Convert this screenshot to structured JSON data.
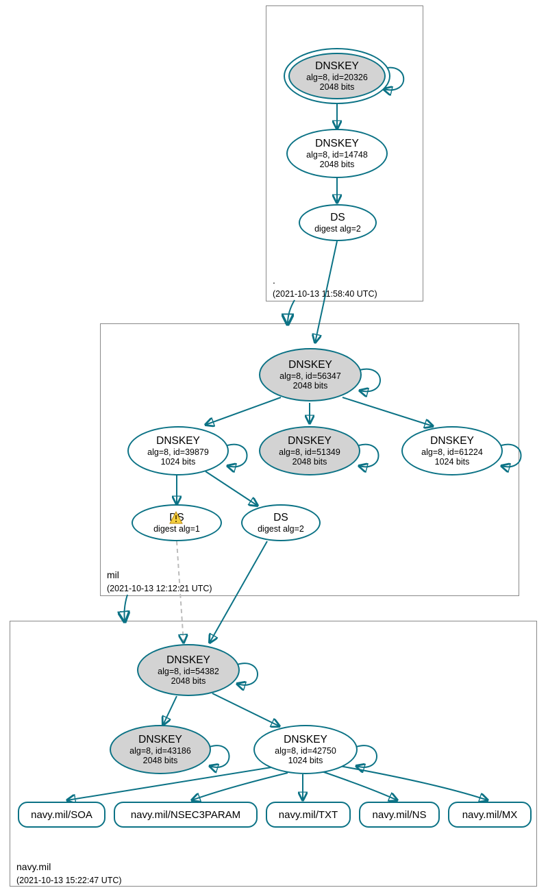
{
  "colors": {
    "accent": "#0b7285",
    "fill": "#d3d3d3"
  },
  "zones": {
    "root": {
      "name": ".",
      "date": "(2021-10-13 11:58:40 UTC)"
    },
    "mil": {
      "name": "mil",
      "date": "(2021-10-13 12:12:21 UTC)"
    },
    "navymil": {
      "name": "navy.mil",
      "date": "(2021-10-13 15:22:47 UTC)"
    }
  },
  "nodes": {
    "root_ksk": {
      "title": "DNSKEY",
      "sub1": "alg=8, id=20326",
      "sub2": "2048 bits"
    },
    "root_zsk": {
      "title": "DNSKEY",
      "sub1": "alg=8, id=14748",
      "sub2": "2048 bits"
    },
    "root_ds": {
      "title": "DS",
      "sub1": "digest alg=2"
    },
    "mil_ksk": {
      "title": "DNSKEY",
      "sub1": "alg=8, id=56347",
      "sub2": "2048 bits"
    },
    "mil_k1": {
      "title": "DNSKEY",
      "sub1": "alg=8, id=39879",
      "sub2": "1024 bits"
    },
    "mil_k2": {
      "title": "DNSKEY",
      "sub1": "alg=8, id=51349",
      "sub2": "2048 bits"
    },
    "mil_k3": {
      "title": "DNSKEY",
      "sub1": "alg=8, id=61224",
      "sub2": "1024 bits"
    },
    "mil_ds1": {
      "title": "DS",
      "sub1": "digest alg=1"
    },
    "mil_ds2": {
      "title": "DS",
      "sub1": "digest alg=2"
    },
    "nm_ksk": {
      "title": "DNSKEY",
      "sub1": "alg=8, id=54382",
      "sub2": "2048 bits"
    },
    "nm_k1": {
      "title": "DNSKEY",
      "sub1": "alg=8, id=43186",
      "sub2": "2048 bits"
    },
    "nm_k2": {
      "title": "DNSKEY",
      "sub1": "alg=8, id=42750",
      "sub2": "1024 bits"
    }
  },
  "rr": {
    "soa": "navy.mil/SOA",
    "nsec3param": "navy.mil/NSEC3PARAM",
    "txt": "navy.mil/TXT",
    "ns": "navy.mil/NS",
    "mx": "navy.mil/MX"
  },
  "chart_data": {
    "type": "graph",
    "title": "DNSSEC delegation chain for navy.mil",
    "zones": [
      {
        "name": ".",
        "snapshot": "2021-10-13 11:58:40 UTC"
      },
      {
        "name": "mil",
        "snapshot": "2021-10-13 12:12:21 UTC"
      },
      {
        "name": "navy.mil",
        "snapshot": "2021-10-13 15:22:47 UTC"
      }
    ],
    "nodes": [
      {
        "id": "root_ksk",
        "zone": ".",
        "type": "DNSKEY",
        "alg": 8,
        "key_id": 20326,
        "bits": 2048,
        "sep": true,
        "trust_anchor": true
      },
      {
        "id": "root_zsk",
        "zone": ".",
        "type": "DNSKEY",
        "alg": 8,
        "key_id": 14748,
        "bits": 2048,
        "sep": false
      },
      {
        "id": "root_ds",
        "zone": ".",
        "type": "DS",
        "digest_alg": 2
      },
      {
        "id": "mil_ksk",
        "zone": "mil",
        "type": "DNSKEY",
        "alg": 8,
        "key_id": 56347,
        "bits": 2048,
        "sep": true
      },
      {
        "id": "mil_k1",
        "zone": "mil",
        "type": "DNSKEY",
        "alg": 8,
        "key_id": 39879,
        "bits": 1024
      },
      {
        "id": "mil_k2",
        "zone": "mil",
        "type": "DNSKEY",
        "alg": 8,
        "key_id": 51349,
        "bits": 2048,
        "sep": true
      },
      {
        "id": "mil_k3",
        "zone": "mil",
        "type": "DNSKEY",
        "alg": 8,
        "key_id": 61224,
        "bits": 1024
      },
      {
        "id": "mil_ds1",
        "zone": "mil",
        "type": "DS",
        "digest_alg": 1,
        "warning": true
      },
      {
        "id": "mil_ds2",
        "zone": "mil",
        "type": "DS",
        "digest_alg": 2
      },
      {
        "id": "nm_ksk",
        "zone": "navy.mil",
        "type": "DNSKEY",
        "alg": 8,
        "key_id": 54382,
        "bits": 2048,
        "sep": true
      },
      {
        "id": "nm_k1",
        "zone": "navy.mil",
        "type": "DNSKEY",
        "alg": 8,
        "key_id": 43186,
        "bits": 2048,
        "sep": true
      },
      {
        "id": "nm_k2",
        "zone": "navy.mil",
        "type": "DNSKEY",
        "alg": 8,
        "key_id": 42750,
        "bits": 1024
      },
      {
        "id": "rr_soa",
        "zone": "navy.mil",
        "type": "RRset",
        "name": "navy.mil/SOA"
      },
      {
        "id": "rr_n3p",
        "zone": "navy.mil",
        "type": "RRset",
        "name": "navy.mil/NSEC3PARAM"
      },
      {
        "id": "rr_txt",
        "zone": "navy.mil",
        "type": "RRset",
        "name": "navy.mil/TXT"
      },
      {
        "id": "rr_ns",
        "zone": "navy.mil",
        "type": "RRset",
        "name": "navy.mil/NS"
      },
      {
        "id": "rr_mx",
        "zone": "navy.mil",
        "type": "RRset",
        "name": "navy.mil/MX"
      }
    ],
    "edges": [
      {
        "from": "root_ksk",
        "to": "root_ksk",
        "self": true
      },
      {
        "from": "root_ksk",
        "to": "root_zsk"
      },
      {
        "from": "root_zsk",
        "to": "root_ds"
      },
      {
        "from": "root_ds",
        "to": "mil_ksk"
      },
      {
        "from": "mil_ksk",
        "to": "mil_ksk",
        "self": true
      },
      {
        "from": "mil_ksk",
        "to": "mil_k1"
      },
      {
        "from": "mil_ksk",
        "to": "mil_k2"
      },
      {
        "from": "mil_ksk",
        "to": "mil_k3"
      },
      {
        "from": "mil_k1",
        "to": "mil_k1",
        "self": true
      },
      {
        "from": "mil_k2",
        "to": "mil_k2",
        "self": true
      },
      {
        "from": "mil_k3",
        "to": "mil_k3",
        "self": true
      },
      {
        "from": "mil_k1",
        "to": "mil_ds1"
      },
      {
        "from": "mil_k1",
        "to": "mil_ds2"
      },
      {
        "from": "mil_ds1",
        "to": "nm_ksk",
        "style": "dashed"
      },
      {
        "from": "mil_ds2",
        "to": "nm_ksk"
      },
      {
        "from": "nm_ksk",
        "to": "nm_ksk",
        "self": true
      },
      {
        "from": "nm_ksk",
        "to": "nm_k1"
      },
      {
        "from": "nm_ksk",
        "to": "nm_k2"
      },
      {
        "from": "nm_k1",
        "to": "nm_k1",
        "self": true
      },
      {
        "from": "nm_k2",
        "to": "nm_k2",
        "self": true
      },
      {
        "from": "nm_k2",
        "to": "rr_soa"
      },
      {
        "from": "nm_k2",
        "to": "rr_n3p"
      },
      {
        "from": "nm_k2",
        "to": "rr_txt"
      },
      {
        "from": "nm_k2",
        "to": "rr_ns"
      },
      {
        "from": "nm_k2",
        "to": "rr_mx"
      }
    ]
  }
}
